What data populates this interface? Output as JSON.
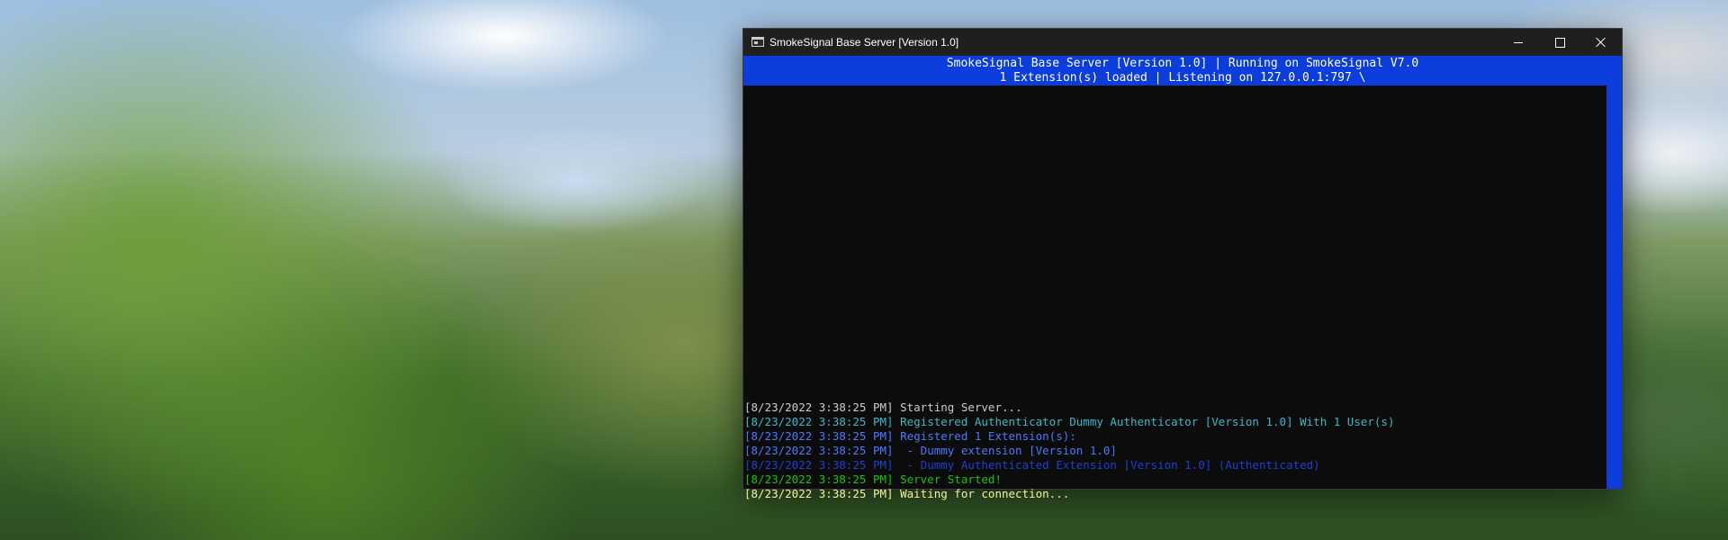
{
  "desktop": {
    "wallpaper": "forest-valley-photo"
  },
  "window": {
    "title": "SmokeSignal Base Server [Version 1.0]",
    "icon": "console-app-icon",
    "controls": {
      "minimize": "minimize-icon",
      "maximize": "maximize-icon",
      "close": "close-icon"
    }
  },
  "header": {
    "line1": "SmokeSignal Base Server [Version 1.0] | Running on SmokeSignal V7.0",
    "line2": "1 Extension(s) loaded | Listening on 127.0.0.1:797 \\"
  },
  "colors": {
    "header_bg": "#0a3ddb",
    "console_bg": "#0c0c0c",
    "log_default": "#cccccc",
    "log_cyan": "#3ab8c8",
    "log_blue": "#4a78ff",
    "log_darkblue": "#1e3fcf",
    "log_green": "#16c60c",
    "log_yellow": "#f9f1a5"
  },
  "log": [
    {
      "timestamp": "[8/23/2022 3:38:25 PM]",
      "message": " Starting Server...",
      "color": "#cccccc"
    },
    {
      "timestamp": "[8/23/2022 3:38:25 PM]",
      "message": " Registered Authenticator Dummy Authenticator [Version 1.0] With 1 User(s)",
      "color": "#3ab8c8"
    },
    {
      "timestamp": "[8/23/2022 3:38:25 PM]",
      "message": " Registered 1 Extension(s):",
      "color": "#4a78ff"
    },
    {
      "timestamp": "[8/23/2022 3:38:25 PM]",
      "message": "  - Dummy extension [Version 1.0]",
      "color": "#4a78ff"
    },
    {
      "timestamp": "[8/23/2022 3:38:25 PM]",
      "message": "  - Dummy Authenticated Extension [Version 1.0] (Authenticated)",
      "color": "#1e3fcf"
    },
    {
      "timestamp": "[8/23/2022 3:38:25 PM]",
      "message": " Server Started!",
      "color": "#16c60c"
    },
    {
      "timestamp": "[8/23/2022 3:38:25 PM]",
      "message": " Waiting for connection...",
      "color": "#f9f1a5"
    }
  ]
}
